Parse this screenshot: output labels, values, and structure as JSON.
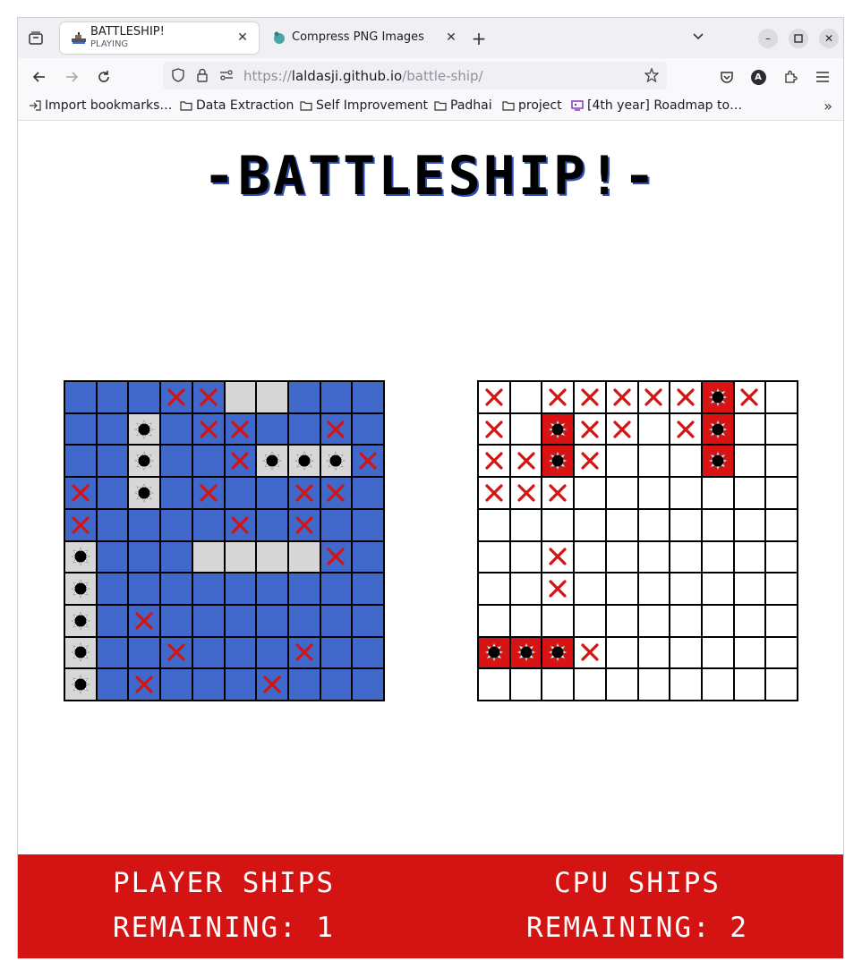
{
  "browser": {
    "tabs": [
      {
        "title": "BATTLESHIP!",
        "subtitle": "PLAYING",
        "active": true
      },
      {
        "title": "Compress PNG Images O",
        "active": false
      }
    ],
    "url": {
      "prefix": "https://",
      "host": "laldasji.github.io",
      "path": "/battle-ship/"
    },
    "bookmarks": [
      {
        "label": "Import bookmarks…",
        "icon": "import-icon"
      },
      {
        "label": "Data Extraction",
        "icon": "folder-icon"
      },
      {
        "label": "Self Improvement",
        "icon": "folder-icon"
      },
      {
        "label": "Padhai",
        "icon": "folder-icon"
      },
      {
        "label": "project",
        "icon": "folder-icon"
      },
      {
        "label": "[4th year] Roadmap to…",
        "icon": "roadmap-icon"
      }
    ],
    "profile_initial": "A"
  },
  "game": {
    "title": "-BATTLESHIP!-",
    "player_board": [
      "WWWXXSSWWW",
      "WWHWXXWWXW",
      "WWHWWXHHHX",
      "XWHWXWWXXW",
      "XWWWWXWXWW",
      "HWWWSSSSXW",
      "HWWWWWWWWW",
      "HWXWWWWWWW",
      "HWWXWWWXWW",
      "HWXWWWXWWW"
    ],
    "cpu_board": [
      "X.XXXXXRX.",
      "X.RXX.XR..",
      "XXRX...R..",
      "XXX.......",
      "..........",
      "..X.......",
      "..X.......",
      "..........",
      "RRRX......",
      ".........."
    ],
    "legend": {
      "W": "water",
      "S": "ship",
      "H": "ship-hit",
      "X": "miss",
      ".": "unknown",
      "R": "enemy-hit"
    },
    "footer": {
      "player_line1": "PLAYER SHIPS",
      "player_line2": "REMAINING: 1",
      "cpu_line1": "CPU SHIPS",
      "cpu_line2": "REMAINING: 2"
    }
  },
  "colors": {
    "sea": "#4169cb",
    "ship": "#d7d7d7",
    "miss_x": "#d41313",
    "hit_red": "#d91313",
    "footer_bg": "#d41313"
  }
}
